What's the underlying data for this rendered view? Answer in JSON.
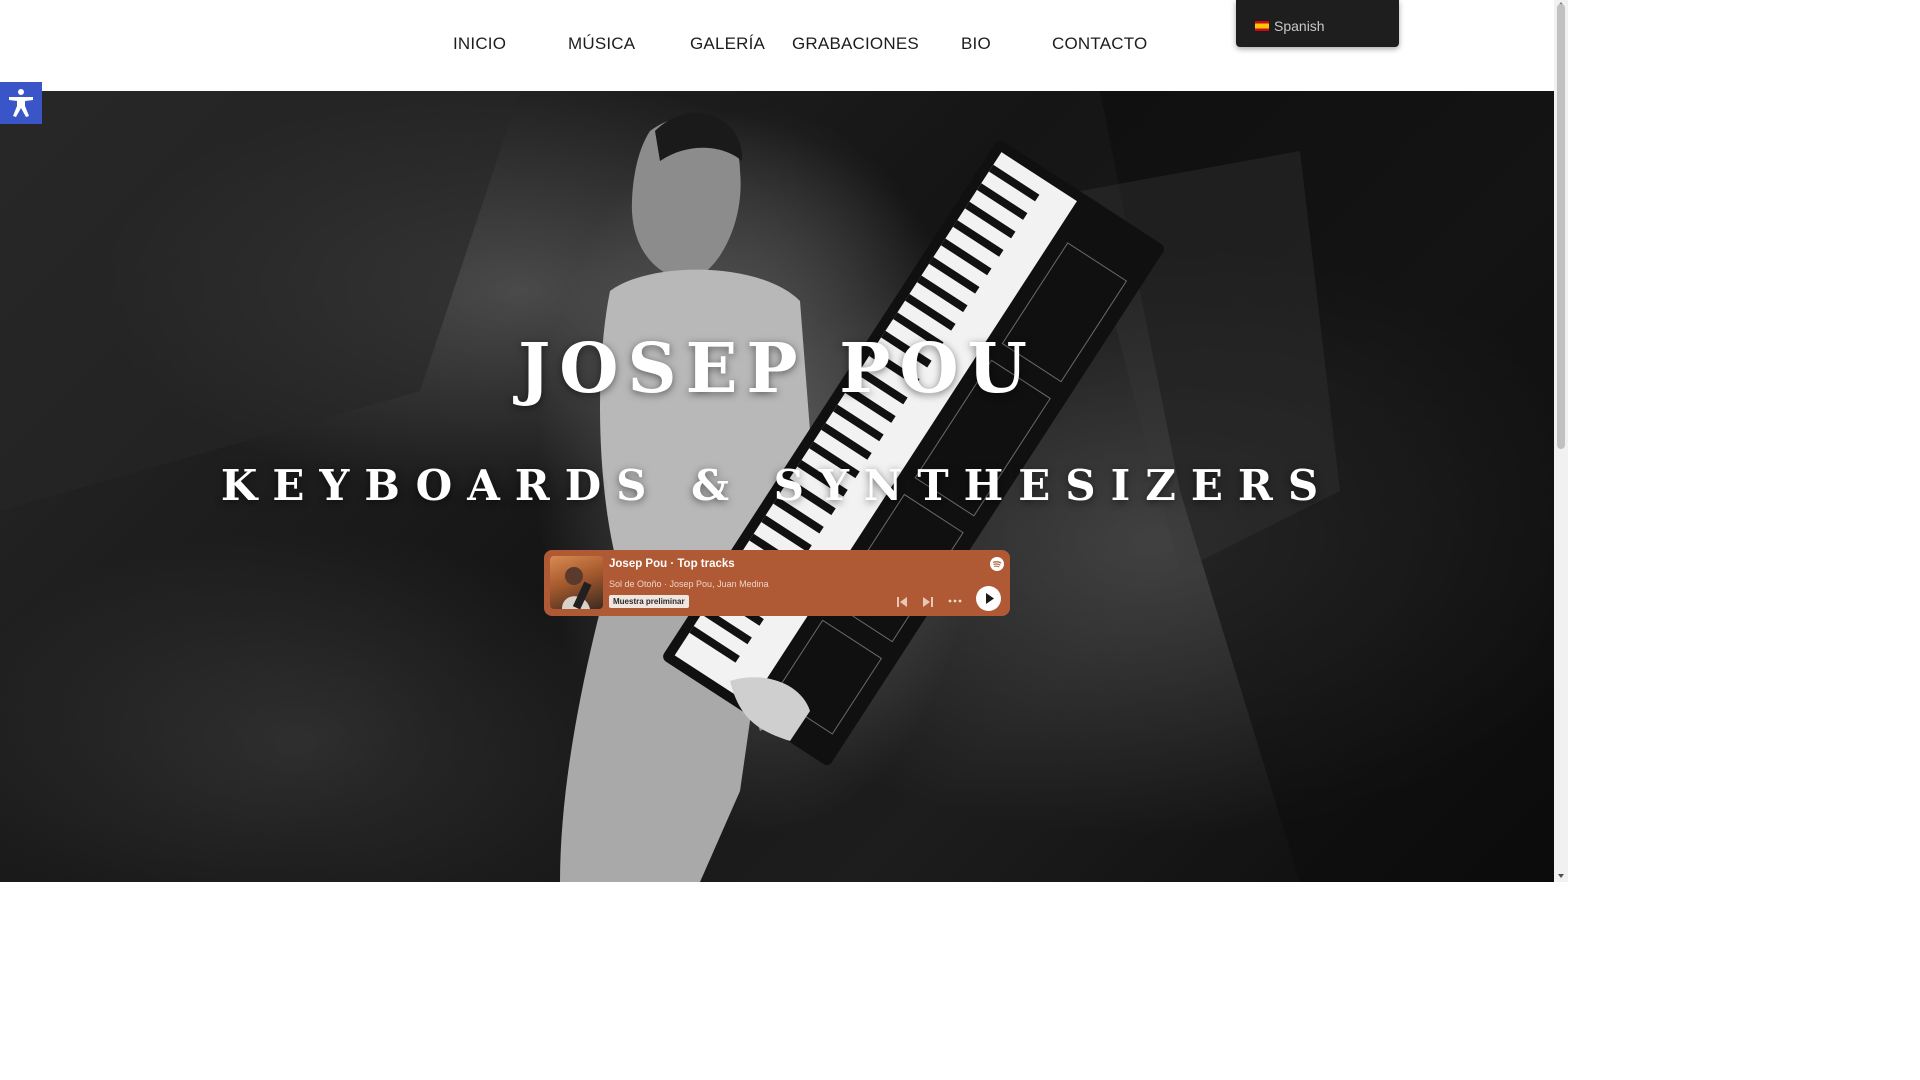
{
  "nav": {
    "items": [
      {
        "label": "INICIO"
      },
      {
        "label": "MÚSICA"
      },
      {
        "label": "GALERÍA"
      },
      {
        "label": "GRABACIONES"
      },
      {
        "label": "BIO"
      },
      {
        "label": "CONTACTO"
      }
    ]
  },
  "language": {
    "label": "Spanish",
    "flag_icon": "spain-flag-icon"
  },
  "accessibility": {
    "icon": "accessibility-person-icon",
    "color": "#3a55c8"
  },
  "hero": {
    "title": "JOSEP POU",
    "subtitle": "KEYBOARDS & SYNTHESIZERS"
  },
  "player": {
    "title": "Josep Pou · Top tracks",
    "track": "Sol de Otoño · Josep Pou, Juan Medina",
    "badge": "Muestra preliminar",
    "background_color": "#b05a35",
    "icons": [
      "spotify-icon",
      "previous-icon",
      "next-icon",
      "more-icon",
      "play-icon"
    ]
  }
}
